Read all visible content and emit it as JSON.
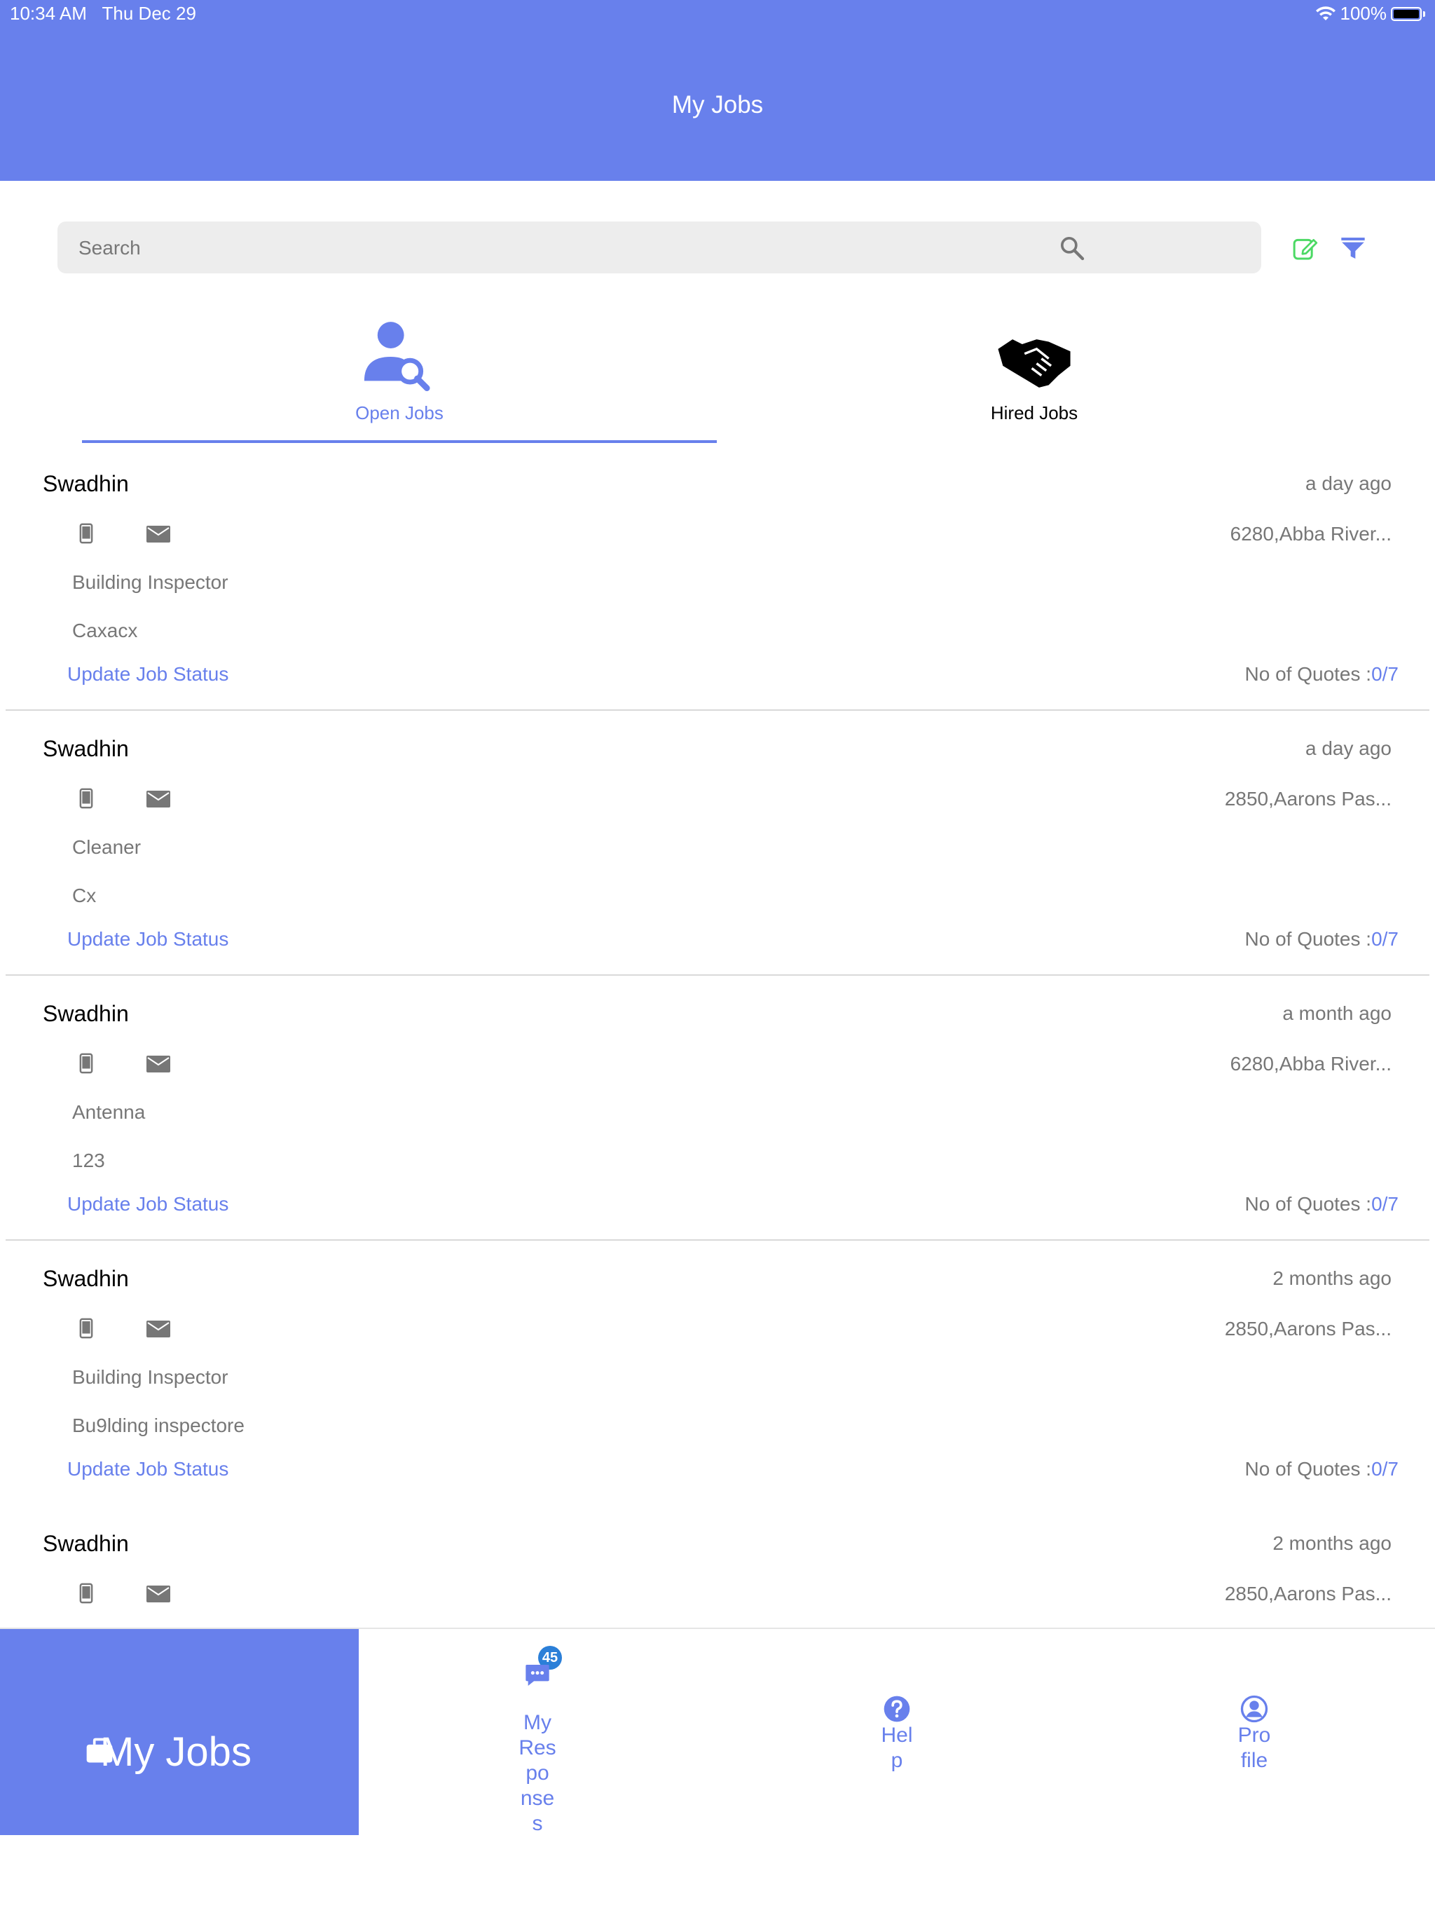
{
  "status_bar": {
    "time": "10:34 AM",
    "date": "Thu Dec 29",
    "battery": "100%"
  },
  "header": {
    "title": "My Jobs"
  },
  "search": {
    "placeholder": "Search"
  },
  "tabs": [
    {
      "label": "Open Jobs",
      "icon": "person-search-icon",
      "active": true
    },
    {
      "label": "Hired Jobs",
      "icon": "handshake-icon",
      "active": false
    }
  ],
  "jobs": [
    {
      "name": "Swadhin",
      "time": "a day ago",
      "location": "6280,Abba River...",
      "category": "Building Inspector",
      "description": "Caxacx",
      "update_label": "Update Job Status",
      "quotes_label": "No of Quotes :",
      "quotes_value": "0/7"
    },
    {
      "name": "Swadhin",
      "time": "a day ago",
      "location": "2850,Aarons Pas...",
      "category": "Cleaner",
      "description": "Cx",
      "update_label": "Update Job Status",
      "quotes_label": "No of Quotes :",
      "quotes_value": "0/7"
    },
    {
      "name": "Swadhin",
      "time": "a month ago",
      "location": "6280,Abba River...",
      "category": "Antenna",
      "description": "123",
      "update_label": "Update Job Status",
      "quotes_label": "No of Quotes :",
      "quotes_value": "0/7"
    },
    {
      "name": "Swadhin",
      "time": "2 months ago",
      "location": "2850,Aarons Pas...",
      "category": "Building Inspector",
      "description": "Bu9lding inspectore",
      "update_label": "Update Job Status",
      "quotes_label": "No of Quotes :",
      "quotes_value": "0/7"
    },
    {
      "name": "Swadhin",
      "time": "2 months ago",
      "location": "2850,Aarons Pas...",
      "category": "",
      "description": "",
      "update_label": "",
      "quotes_label": "",
      "quotes_value": ""
    }
  ],
  "bottom_nav": {
    "my_jobs": "My Jobs",
    "responses_lines": [
      "My",
      "Res",
      "po",
      "nse",
      "s"
    ],
    "responses_badge": "45",
    "help_lines": [
      "Hel",
      "p"
    ],
    "profile_lines": [
      "Pro",
      "file"
    ]
  },
  "colors": {
    "primary": "#6880EC",
    "badge": "#2B7FD8",
    "edit_icon": "#4CD964",
    "muted_text": "#777777"
  }
}
